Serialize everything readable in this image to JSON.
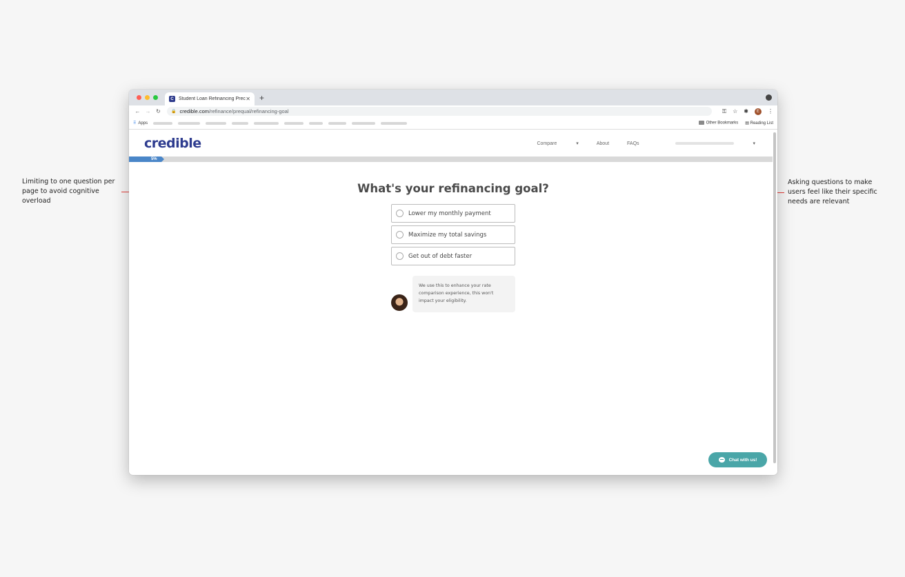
{
  "annotations": {
    "left": "Limiting to one question per page to avoid cognitive overload",
    "right": "Asking questions to make users feel like their specific needs are relevant"
  },
  "browser": {
    "tab_title": "Student Loan Refinancing Prec",
    "favicon_letter": "C",
    "url_host": "credible.com",
    "url_path": "/refinance/prequal/refinancing-goal",
    "bookmarks_apps": "Apps",
    "other_bookmarks": "Other Bookmarks",
    "reading_list": "Reading List",
    "profile_initial": "E"
  },
  "site": {
    "logo": "credible",
    "nav": {
      "compare": "Compare",
      "about": "About",
      "faqs": "FAQs"
    },
    "progress": {
      "label": "5%",
      "value": 0.05
    },
    "question": "What's your refinancing goal?",
    "options": [
      "Lower my monthly payment",
      "Maximize my total savings",
      "Get out of debt faster"
    ],
    "helper_text": "We use this to enhance your rate comparison experience, this won't impact your eligibility.",
    "chat_button": "Chat with us!"
  },
  "colors": {
    "brand": "#2e3c8f",
    "progress": "#4a86c8",
    "chat": "#4aa6a8",
    "annotation_arrow": "#e53935"
  }
}
